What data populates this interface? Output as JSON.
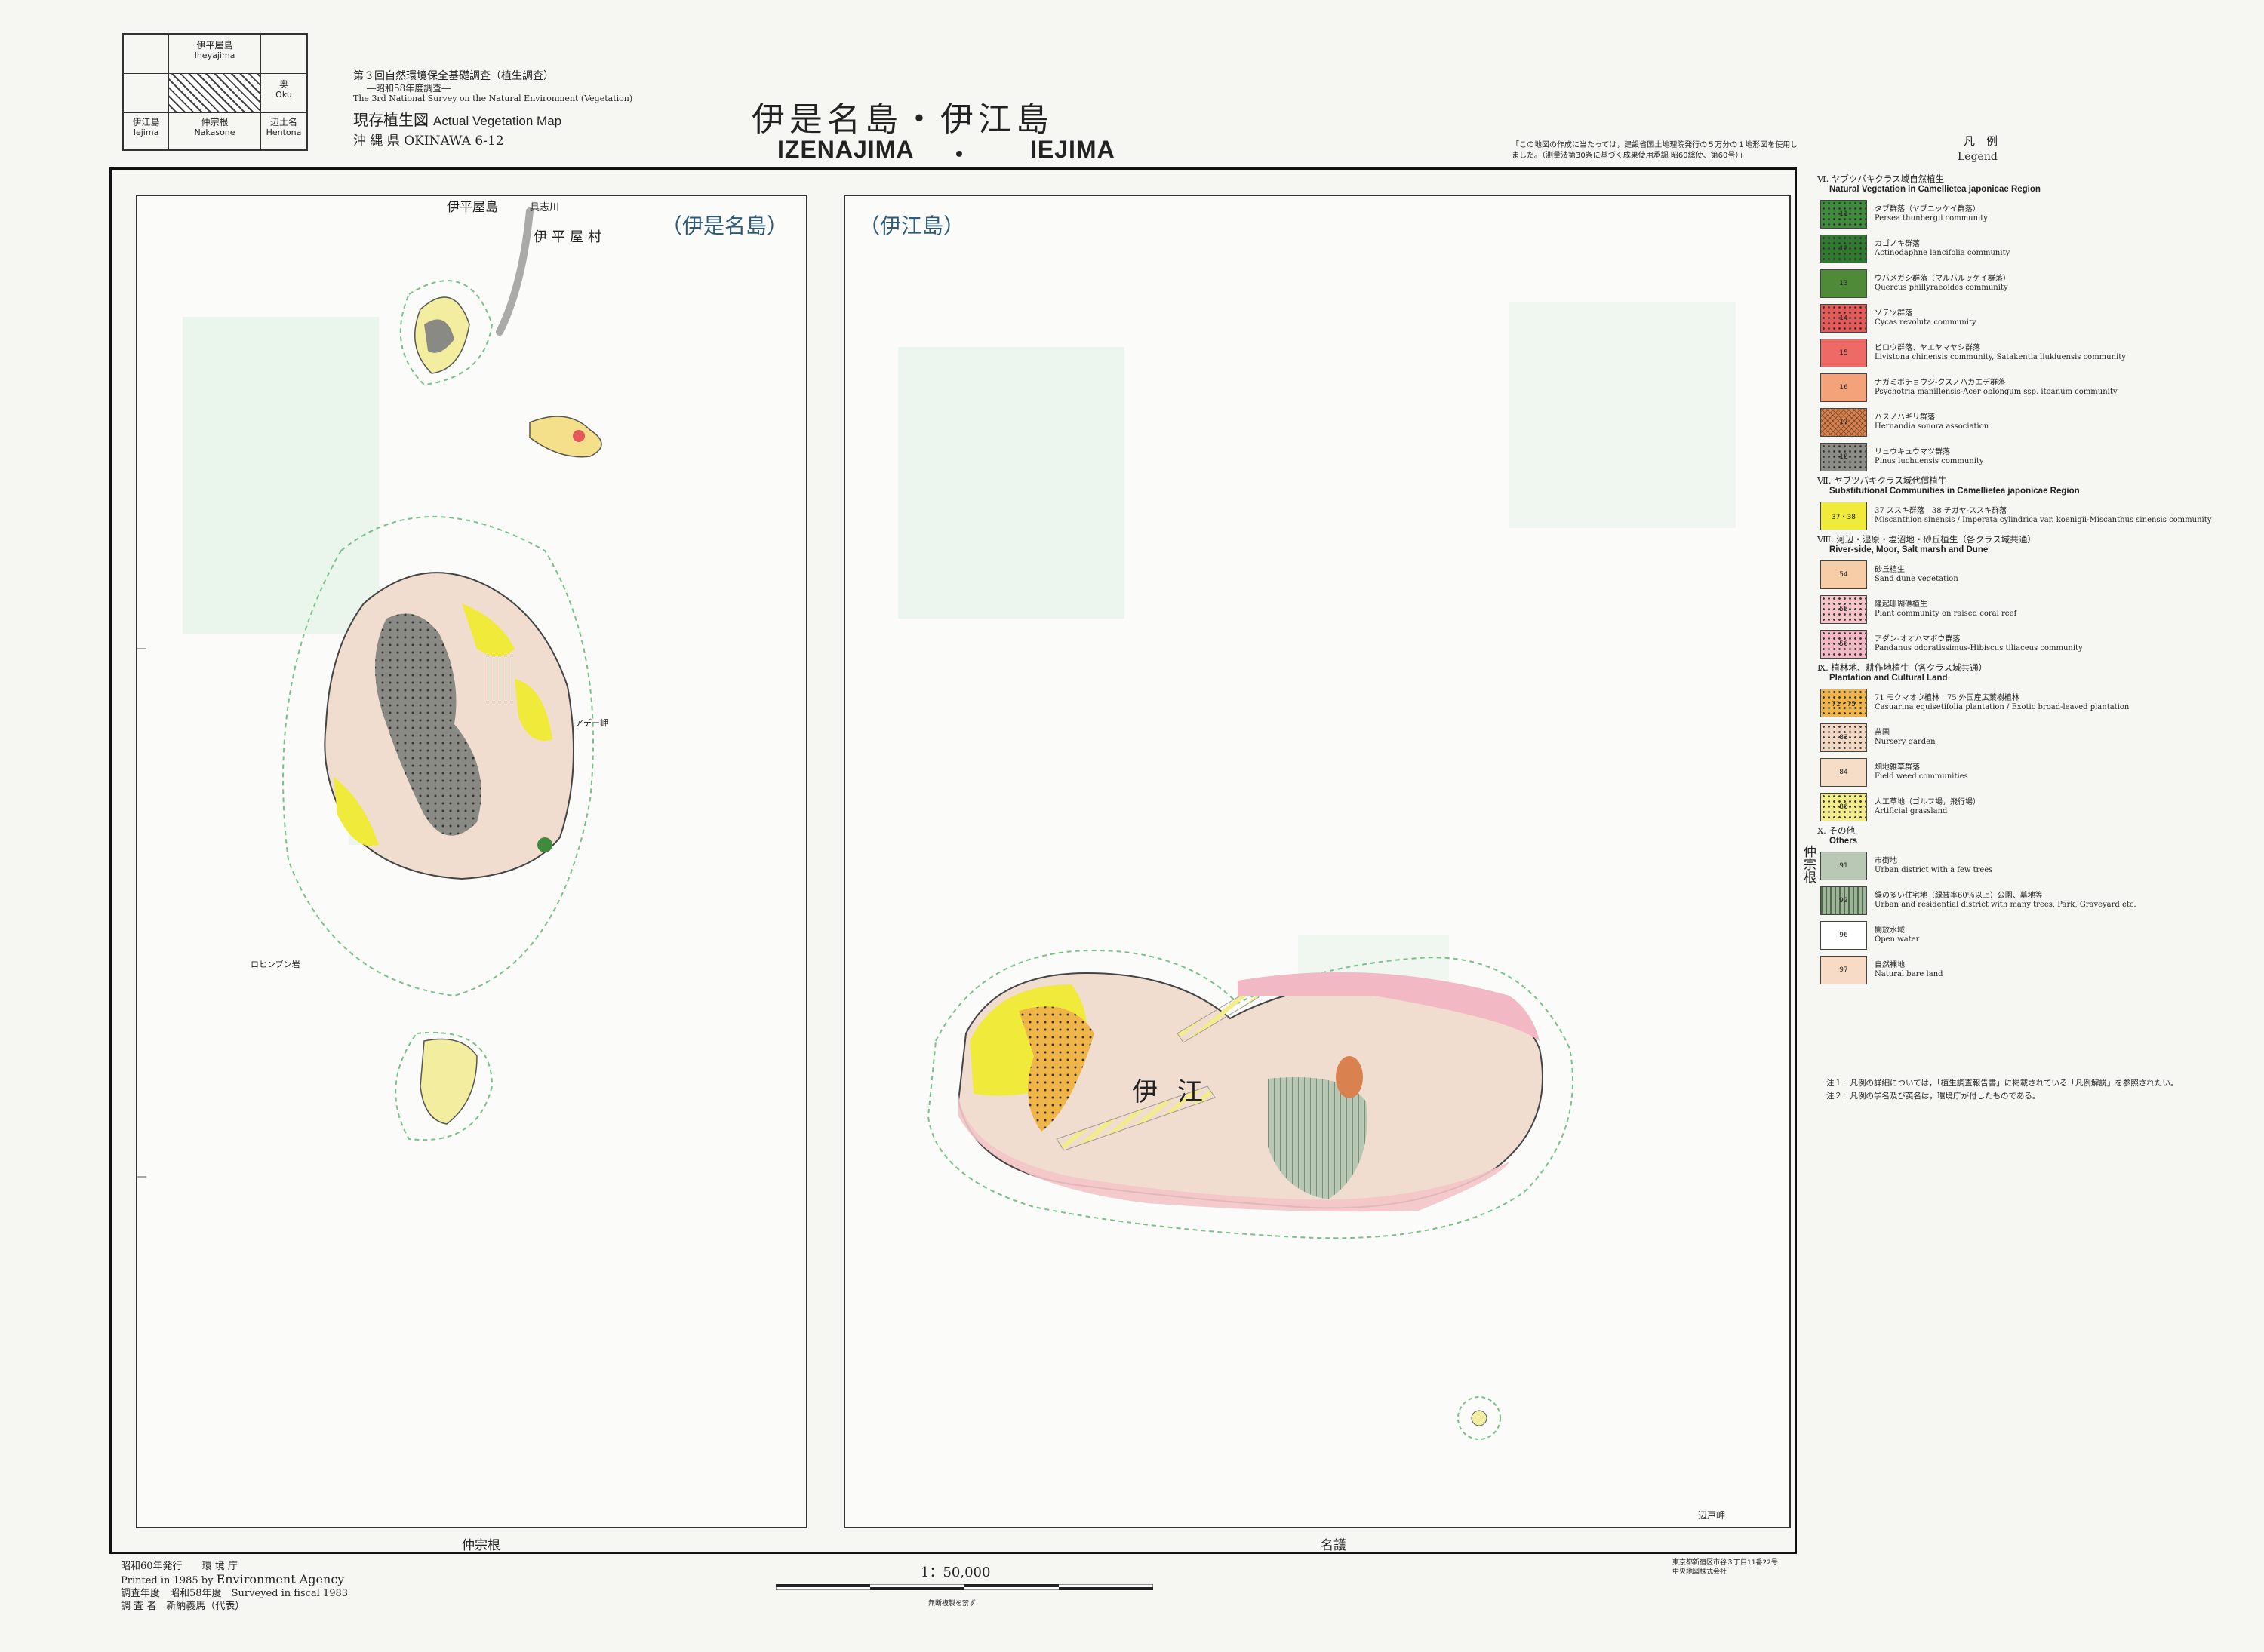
{
  "index_map": {
    "cells": [
      {
        "jp": "伊平屋島",
        "en": "Iheyajima"
      },
      {
        "jp": "奥",
        "en": "Oku"
      },
      {
        "jp": "伊江島",
        "en": "Iejima"
      },
      {
        "jp": "仲宗根",
        "en": "Nakasone"
      },
      {
        "jp": "辺土名",
        "en": "Hentona"
      }
    ]
  },
  "header": {
    "survey_title": "第３回自然環境保全基礎調査（植生調査）",
    "survey_year": "―昭和58年度調査―",
    "survey_en": "The 3rd National Survey on the Natural Environment (Vegetation)",
    "map_type_jp": "現存植生図",
    "map_type_en": "Actual Vegetation Map",
    "prefecture": "沖 縄 県 OKINAWA 6-12",
    "title_jp": "伊是名島・伊江島",
    "title_en_1": "IZENAJIMA",
    "title_en_dot": "・",
    "title_en_2": "IEJIMA",
    "source_note": "「この地図の作成に当たっては，建設省国土地理院発行の５万分の１地形図を使用しました。（測量法第30条に基づく成果使用承認 昭60総使、第60号）」"
  },
  "legend": {
    "title_jp": "凡　例",
    "title_en": "Legend",
    "sections": [
      {
        "head_jp": "Ⅵ. ヤブツバキクラス域自然植生",
        "head_en": "Natural Vegetation in Camellietea japonicae Region",
        "items": [
          {
            "code": "11",
            "jp": "タブ群落（ヤブニッケイ群落）",
            "en": "Persea thunbergii community",
            "color": "#3f8a3c",
            "pattern": "dot-dark"
          },
          {
            "code": "12",
            "jp": "カゴノキ群落",
            "en": "Actinodaphne lancifolia community",
            "color": "#2f7a2f",
            "pattern": "dot-dark"
          },
          {
            "code": "13",
            "jp": "ウバメガシ群落（マルバルッケイ群落）",
            "en": "Quercus phillyraeoides community",
            "color": "#4f8a38",
            "pattern": "solid"
          },
          {
            "code": "14",
            "jp": "ソテツ群落",
            "en": "Cycas revoluta community",
            "color": "#e35a58",
            "pattern": "dot-dark"
          },
          {
            "code": "15",
            "jp": "ビロウ群落、ヤエヤマヤシ群落",
            "en": "Livistona chinensis community, Satakentia liukiuensis community",
            "color": "#ee6a66",
            "pattern": "solid"
          },
          {
            "code": "16",
            "jp": "ナガミボチョウジ-クスノハカエデ群落",
            "en": "Psychotria manillensis-Acer oblongum ssp. itoanum community",
            "color": "#f3a27a",
            "pattern": "solid"
          },
          {
            "code": "17",
            "jp": "ハスノハギリ群落",
            "en": "Hernandia sonora association",
            "color": "#d9824f",
            "pattern": "cross"
          },
          {
            "code": "18",
            "jp": "リュウキュウマツ群落",
            "en": "Pinus luchuensis community",
            "color": "#8c8c86",
            "pattern": "dot-dark"
          }
        ]
      },
      {
        "head_jp": "Ⅶ. ヤブツバキクラス域代償植生",
        "head_en": "Substitutional Communities in Camellietea japonicae Region",
        "items": [
          {
            "code": "37・38",
            "jp": "37 ススキ群落　38 チガヤ-ススキ群落",
            "en": "Miscanthion sinensis / Imperata cylindrica var. koenigii-Miscanthus sinensis community",
            "color": "#f0ea3a",
            "pattern": "solid"
          }
        ]
      },
      {
        "head_jp": "Ⅷ. 河辺・湿原・塩沼地・砂丘植生（各クラス域共通）",
        "head_en": "River-side, Moor, Salt marsh and Dune",
        "items": [
          {
            "code": "54",
            "jp": "砂丘植生",
            "en": "Sand dune vegetation",
            "color": "#f7cda8",
            "pattern": "solid"
          },
          {
            "code": "55",
            "jp": "隆起珊瑚礁植生",
            "en": "Plant community on raised coral reef",
            "color": "#f4c4c8",
            "pattern": "dot-dark"
          },
          {
            "code": "56",
            "jp": "アダン-オオハマボウ群落",
            "en": "Pandanus odoratissimus-Hibiscus tiliaceus community",
            "color": "#f2b8c4",
            "pattern": "dot-dark"
          }
        ]
      },
      {
        "head_jp": "Ⅸ. 植林地、耕作地植生（各クラス域共通）",
        "head_en": "Plantation and Cultural Land",
        "items": [
          {
            "code": "71・75",
            "jp": "71 モクマオウ植林　75 外国産広葉樹植林",
            "en": "Casuarina equisetifolia plantation / Exotic broad-leaved plantation",
            "color": "#f0b548",
            "pattern": "dot-dark"
          },
          {
            "code": "83",
            "jp": "苗圃",
            "en": "Nursery garden",
            "color": "#f1d6c2",
            "pattern": "dot-dark"
          },
          {
            "code": "84",
            "jp": "畑地雑草群落",
            "en": "Field weed communities",
            "color": "#f6ddc8",
            "pattern": "solid"
          },
          {
            "code": "86",
            "jp": "人工草地（ゴルフ場，飛行場）",
            "en": "Artificial grassland",
            "color": "#f3ec8a",
            "pattern": "dot-dark"
          }
        ]
      },
      {
        "head_jp": "Ⅹ. その他",
        "head_en": "Others",
        "items": [
          {
            "code": "91",
            "jp": "市街地",
            "en": "Urban district with a few trees",
            "color": "#b8c8b4",
            "pattern": "solid"
          },
          {
            "code": "92",
            "jp": "緑の多い住宅地（緑被率60％以上）公園、墓地等",
            "en": "Urban and residential district with many trees, Park, Graveyard etc.",
            "color": "#9fb39a",
            "pattern": "stripe"
          },
          {
            "code": "96",
            "jp": "開放水域",
            "en": "Open water",
            "color": "#ffffff",
            "pattern": "solid"
          },
          {
            "code": "97",
            "jp": "自然裸地",
            "en": "Natural bare land",
            "color": "#f7dbc6",
            "pattern": "solid"
          }
        ]
      }
    ],
    "note_1": "注１．凡例の詳細については，「植生調査報告書」に掲載されている「凡例解説」を参照されたい。",
    "note_2": "注２．凡例の学名及び英名は，環境庁が付したものである。"
  },
  "map": {
    "izena_label": "（伊是名島）",
    "ie_label": "（伊江島）",
    "north_sheet": "伊平屋島",
    "bottom_left_sheet": "仲宗根",
    "bottom_right_sheet": "名護",
    "right_sheet": "仲宗根",
    "place_iheya_village": "伊平屋村",
    "place_gushikawa": "具志川",
    "place_ie_town": "伊江",
    "place_bottom_corner": "辺戸岬",
    "place_izena_west": "ロヒンブン岩",
    "place_izena_east": "アデー岬"
  },
  "footer": {
    "published": "昭和60年発行",
    "agency_jp": "環 境 庁",
    "printed": "Printed in 1985 by",
    "agency_en": "Environment Agency",
    "surveyed_label": "調査年度",
    "surveyed_jp": "昭和58年度",
    "surveyed_en": "Surveyed in fiscal 1983",
    "surveyor_label": "調 査 者",
    "surveyor": "新納義馬（代表）",
    "scale": "1：50,000",
    "scale_note": "無断複製を禁ず",
    "printer_1": "東京都新宿区市谷３丁目11番22号",
    "printer_2": "中央地図株式会社"
  }
}
